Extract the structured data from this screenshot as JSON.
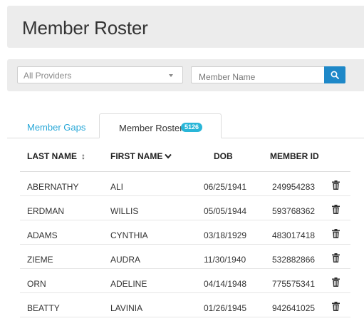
{
  "header": {
    "title": "Member Roster"
  },
  "filters": {
    "provider_selected": "All Providers",
    "member_name_placeholder": "Member Name"
  },
  "tabs": [
    {
      "label": "Member Gaps"
    },
    {
      "label": "Member Roster",
      "badge": "5126"
    }
  ],
  "table": {
    "columns": [
      "LAST NAME",
      "FIRST NAME",
      "DOB",
      "MEMBER ID"
    ],
    "rows": [
      {
        "last": "ABERNATHY",
        "first": "ALI",
        "dob": "06/25/1941",
        "member_id": "249954283"
      },
      {
        "last": "ERDMAN",
        "first": "WILLIS",
        "dob": "05/05/1944",
        "member_id": "593768362"
      },
      {
        "last": "ADAMS",
        "first": "CYNTHIA",
        "dob": "03/18/1929",
        "member_id": "483017418"
      },
      {
        "last": "ZIEME",
        "first": "AUDRA",
        "dob": "11/30/1940",
        "member_id": "532882866"
      },
      {
        "last": "ORN",
        "first": "ADELINE",
        "dob": "04/14/1948",
        "member_id": "775575341"
      },
      {
        "last": "BEATTY",
        "first": "LAVINIA",
        "dob": "01/26/1945",
        "member_id": "942641025"
      }
    ]
  },
  "icons": {
    "sort": "sort-arrows-icon",
    "sort_desc": "chevron-down-icon",
    "search": "search-icon",
    "delete": "trash-icon"
  },
  "colors": {
    "accent": "#29a8d8",
    "button": "#1e88c8",
    "badge": "#29b6d8"
  }
}
